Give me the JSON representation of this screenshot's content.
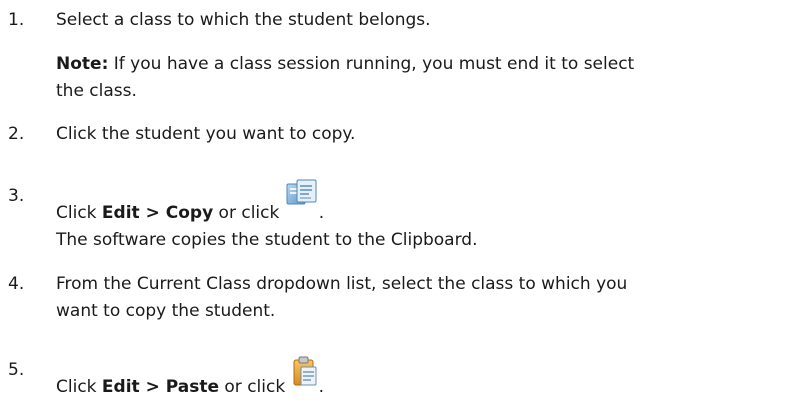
{
  "steps": [
    {
      "number": "1.",
      "text": "Select a class to which the student belongs."
    },
    {
      "number": "2.",
      "text": "Click the student you want to copy."
    },
    {
      "number": "3.",
      "prefix": "Click ",
      "menu": "Edit > Copy",
      "middle": " or click ",
      "icon": "copy-icon",
      "suffix": ".",
      "result": "The software copies the student to the Clipboard."
    },
    {
      "number": "4.",
      "line1": "From the Current Class dropdown list, select the class to which you",
      "line2": "want to copy the student."
    },
    {
      "number": "5.",
      "prefix": "Click ",
      "menu": "Edit > Paste",
      "middle": " or click ",
      "icon": "paste-icon",
      "suffix": "."
    }
  ],
  "note": {
    "label": "Note:",
    "line1": " If you have a class session running, you must end it to select",
    "line2": "the class."
  },
  "colors": {
    "text": "#1a1a1a",
    "copy_icon_blue": "#6fa8dc",
    "paste_icon_orange": "#e8a23a"
  }
}
